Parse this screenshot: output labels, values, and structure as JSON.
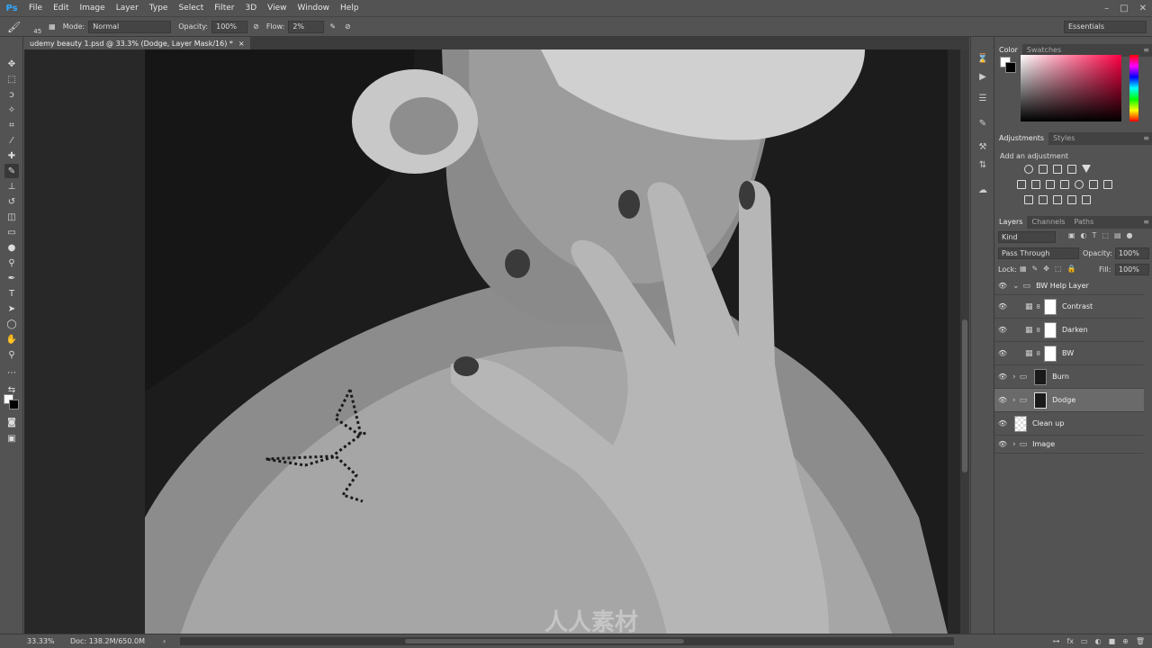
{
  "app": {
    "logo": "Ps"
  },
  "menu": [
    "File",
    "Edit",
    "Image",
    "Layer",
    "Type",
    "Select",
    "Filter",
    "3D",
    "View",
    "Window",
    "Help"
  ],
  "window_controls": [
    "–",
    "□",
    "✕"
  ],
  "options": {
    "brush_size": "45",
    "mode_label": "Mode:",
    "mode_value": "Normal",
    "opacity_label": "Opacity:",
    "opacity_value": "100%",
    "flow_label": "Flow:",
    "flow_value": "2%",
    "workspace": "Essentials"
  },
  "document": {
    "tab_title": "udemy beauty 1.psd @ 33.3% (Dodge, Layer Mask/16) *",
    "close": "×"
  },
  "status": {
    "zoom": "33.33%",
    "doc_size": "Doc: 138.2M/650.0M",
    "arrow": "›"
  },
  "color_panel": {
    "tabs": [
      "Color",
      "Swatches"
    ],
    "menu": "≡",
    "foreground": "#ffffff",
    "background": "#000000"
  },
  "adjustments_panel": {
    "tabs": [
      "Adjustments",
      "Styles"
    ],
    "menu": "≡",
    "title": "Add an adjustment"
  },
  "layers_panel": {
    "tabs": [
      "Layers",
      "Channels",
      "Paths"
    ],
    "menu": "≡",
    "kind": "Kind",
    "blend_mode": "Pass Through",
    "opacity_label": "Opacity:",
    "opacity_value": "100%",
    "lock_label": "Lock:",
    "fill_label": "Fill:",
    "fill_value": "100%",
    "layers": [
      {
        "name": "BW Help Layer",
        "type": "group"
      },
      {
        "name": "Contrast",
        "type": "adjustment"
      },
      {
        "name": "Darken",
        "type": "adjustment"
      },
      {
        "name": "BW",
        "type": "adjustment"
      },
      {
        "name": "Burn",
        "type": "group-mask"
      },
      {
        "name": "Dodge",
        "type": "group-mask",
        "selected": true
      },
      {
        "name": "Clean up",
        "type": "pixel"
      },
      {
        "name": "Image",
        "type": "group"
      }
    ],
    "footer_icons": [
      "fx",
      "◐",
      "▭",
      "■",
      "⊕",
      "🗑"
    ]
  },
  "watermark": "人人素材"
}
